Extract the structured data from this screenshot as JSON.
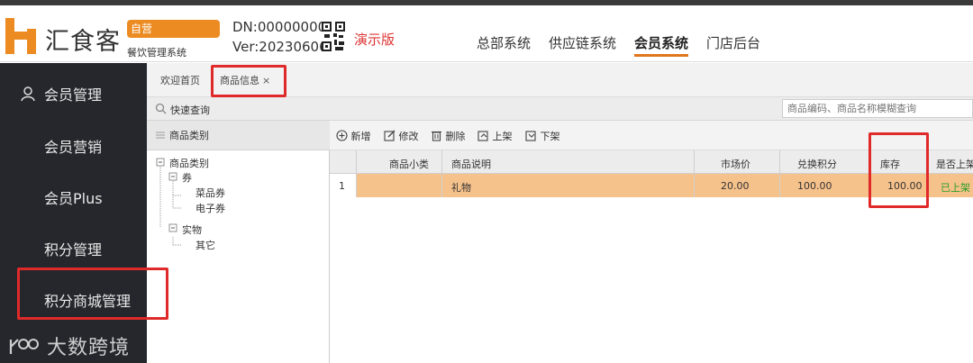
{
  "header": {
    "logo_text": "汇食客",
    "badge": "自营",
    "subtitle": "餐饮管理系统",
    "dn": "DN:00000000",
    "version": "Ver:20230606",
    "demo": "演示版",
    "nav": [
      "总部系统",
      "供应链系统",
      "会员系统",
      "门店后台"
    ],
    "active_nav": "会员系统"
  },
  "sidebar": {
    "items": [
      "会员管理",
      "会员营销",
      "会员Plus",
      "积分管理",
      "积分商城管理"
    ]
  },
  "tabs": {
    "items": [
      "欢迎首页",
      "商品信息"
    ],
    "close_symbol": "×"
  },
  "search": {
    "label": "快速查询",
    "placeholder": "商品编码、商品名称模糊查询"
  },
  "category": {
    "header": "商品类别",
    "tree": [
      {
        "label": "商品类别",
        "level": 0
      },
      {
        "label": "券",
        "level": 1
      },
      {
        "label": "菜品券",
        "level": 2
      },
      {
        "label": "电子券",
        "level": 2
      },
      {
        "label": "实物",
        "level": 1
      },
      {
        "label": "其它",
        "level": 2
      }
    ]
  },
  "toolbar": {
    "new": "新增",
    "edit": "修改",
    "delete": "删除",
    "shelve": "上架",
    "unshelve": "下架"
  },
  "table": {
    "columns": [
      "商品小类",
      "商品说明",
      "市场价",
      "兑换积分",
      "库存",
      "是否上架"
    ],
    "rows": [
      {
        "index": "1",
        "subcategory": "",
        "desc": "礼物",
        "market_price": "20.00",
        "points": "100.00",
        "stock": "100.00",
        "on_shelf": "已上架"
      }
    ]
  },
  "watermark": "大数跨境",
  "colors": {
    "accent": "#ec8b22",
    "highlight_row": "#f6c28c",
    "annotation_red": "#e02a2a",
    "sidebar_bg": "#25272d"
  }
}
